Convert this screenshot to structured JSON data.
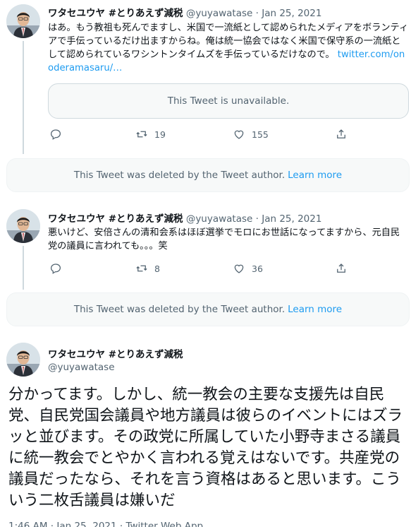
{
  "tweets": [
    {
      "name": "ワタセユウヤ #とりあえず減税",
      "handle": "@yuyawatase",
      "sep": "·",
      "date": "Jan 25, 2021",
      "text": "はあ。もう教祖も死んでますし、米国で一流紙として認められたメディアをボランティアで手伝っているだけ出ますからね。俺は統一協会ではなく米国で保守系の一流紙として認められているワシントンタイムズを手伝っているだけなので。",
      "link": "twitter.com/onoderamasaru/…",
      "quote": "This Tweet is unavailable.",
      "replies": "",
      "retweets": "19",
      "likes": "155"
    },
    {
      "name": "ワタセユウヤ #とりあえず減税",
      "handle": "@yuyawatase",
      "sep": "·",
      "date": "Jan 25, 2021",
      "text": "悪いけど、安倍さんの清和会系はほぼ選挙でモロにお世話になってますから、元自民党の議員に言われても。。。笑",
      "replies": "",
      "retweets": "8",
      "likes": "36"
    }
  ],
  "deleted_notices": [
    {
      "text": "This Tweet was deleted by the Tweet author.",
      "link": "Learn more"
    },
    {
      "text": "This Tweet was deleted by the Tweet author.",
      "link": "Learn more"
    }
  ],
  "main_tweet": {
    "name": "ワタセユウヤ #とりあえず減税",
    "handle": "@yuyawatase",
    "text": "分かってます。しかし、統一教会の主要な支援先は自民党、自民党国会議員や地方議員は彼らのイベントにはズラッと並びます。その政党に所属していた小野寺まさる議員に統一教会でとやかく言われる覚えはないです。共産党の議員だったなら、それを言う資格はあると思います。こういう二枚舌議員は嫌いだ",
    "footer": "1:46 AM · Jan 25, 2021 · Twitter Web App"
  },
  "icons": [
    "avatar",
    "reply-icon",
    "retweet-icon",
    "like-icon",
    "share-icon"
  ],
  "colors": {
    "link": "#1d9bf0",
    "muted": "#536471",
    "text": "#0f1419",
    "line": "#cfd9de"
  }
}
